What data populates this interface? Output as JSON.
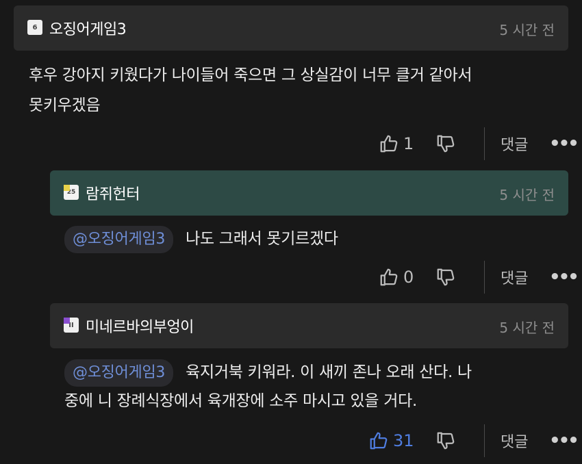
{
  "comments": [
    {
      "username": "오징어게임3",
      "avatar_text": "6",
      "time": "5 시간 전",
      "text_line1": "후우 강아지 키웠다가 나이들어 죽으면 그 상실감이 너무 클거 같아서",
      "text_line2": "못키우겠음",
      "likes": "1",
      "reply_label": "댓글",
      "more": "•••"
    },
    {
      "username": "람쥐헌터",
      "avatar_text": "25",
      "time": "5 시간 전",
      "mention": "@오징어게임3",
      "text": "나도 그래서 못기르겠다",
      "likes": "0",
      "reply_label": "댓글",
      "more": "•••"
    },
    {
      "username": "미네르바의부엉이",
      "avatar_text": "II",
      "time": "5 시간 전",
      "mention": "@오징어게임3",
      "text_line1": "육지거북 키워라. 이 새끼 존나 오래 산다. 나",
      "text_line2": "중에 니 장례식장에서 육개장에 소주 마시고 있을 거다.",
      "likes": "31",
      "reply_label": "댓글",
      "more": "•••"
    }
  ],
  "colors": {
    "background": "#181818",
    "header": "#2b2b2b",
    "header_highlight": "#2d4a45",
    "mention": "#6f8fd8",
    "liked": "#4f7de0"
  },
  "icons": [
    "thumbs-up-icon",
    "thumbs-down-icon",
    "more-icon"
  ]
}
